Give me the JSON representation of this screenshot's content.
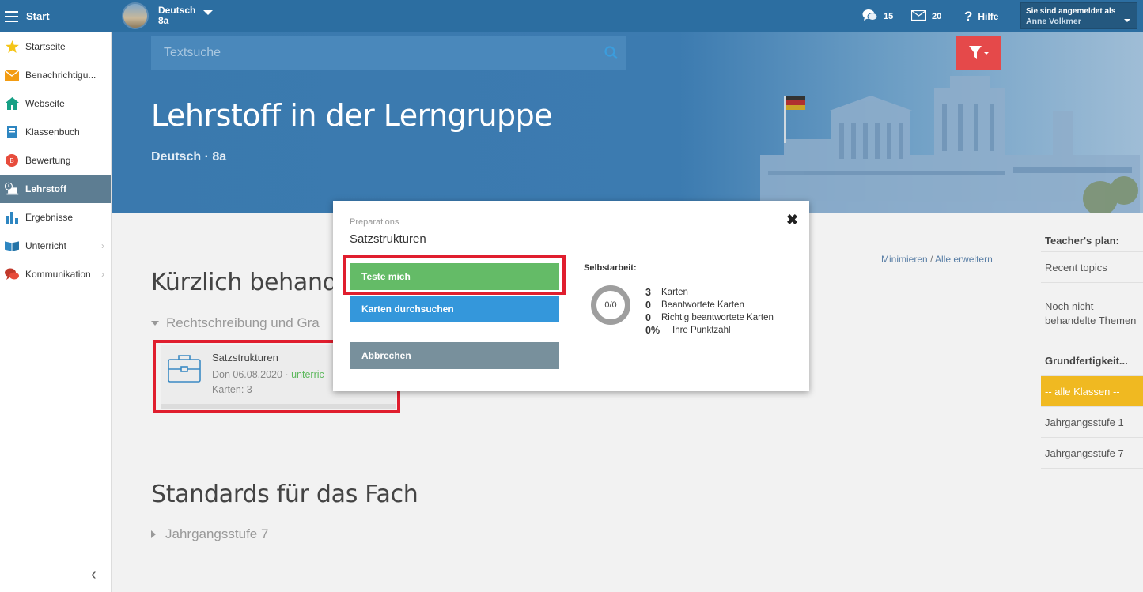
{
  "topbar": {
    "start_label": "Start",
    "group_subject": "Deutsch",
    "group_class": "8a",
    "messages_count": "15",
    "mail_count": "20",
    "help_label": "Hilfe",
    "logged_in_label": "Sie sind angemeldet als",
    "user_name": "Anne Volkmer"
  },
  "sidebar": {
    "items": [
      {
        "label": "Startseite"
      },
      {
        "label": "Benachrichtigu..."
      },
      {
        "label": "Webseite"
      },
      {
        "label": "Klassenbuch"
      },
      {
        "label": "Bewertung"
      },
      {
        "label": "Lehrstoff"
      },
      {
        "label": "Ergebnisse"
      },
      {
        "label": "Unterricht"
      },
      {
        "label": "Kommunikation"
      }
    ],
    "active_index": 5
  },
  "hero": {
    "search_placeholder": "Textsuche",
    "title": "Lehrstoff in der Lerngruppe",
    "subtitle": "Deutsch · 8a"
  },
  "main": {
    "recent_title": "Kürzlich behand",
    "recent_group": "Rechtschreibung und Gra",
    "minimize_label": "Minimieren",
    "links_separator": "/",
    "expand_all_label": "Alle erweitern",
    "card": {
      "title": "Satzstrukturen",
      "date": "Don 06.08.2020 · ",
      "status": "unterric",
      "count": "Karten: 3"
    },
    "standards_title": "Standards für das Fach",
    "standards_group": "Jahrgangsstufe 7"
  },
  "right_panel": {
    "items": [
      {
        "label": "Teacher's plan:",
        "type": "head",
        "height": 29
      },
      {
        "label": "Recent topics",
        "type": "item",
        "height": 39
      },
      {
        "label": "Noch nicht behandelte Themen",
        "type": "item",
        "height": 79
      },
      {
        "label": "Grundfertigkeit...",
        "type": "head",
        "height": 39
      },
      {
        "label": "-- alle Klassen --",
        "type": "sel",
        "height": 39
      },
      {
        "label": "Jahrgangsstufe 1",
        "type": "item",
        "height": 39
      },
      {
        "label": "Jahrgangsstufe 7",
        "type": "item",
        "height": 39
      }
    ]
  },
  "modal": {
    "breadcrumb": "Preparations",
    "title": "Satzstrukturen",
    "close_label": "✖",
    "test_button": "Teste mich",
    "browse_button": "Karten durchsuchen",
    "cancel_button": "Abbrechen",
    "self_label": "Selbstarbeit:",
    "progress_text": "0/0",
    "stats": [
      {
        "num": "3",
        "label": "Karten"
      },
      {
        "num": "0",
        "label": "Beantwortete Karten"
      },
      {
        "num": "0",
        "label": "Richtig beantwortete Karten"
      },
      {
        "num": "0%",
        "label": "Ihre Punktzahl"
      }
    ]
  },
  "colors": {
    "topbar": "#2c6ea1",
    "hero": "#3a79ae",
    "active_nav": "#5d7d92",
    "green_button": "#64bb67",
    "blue_button": "#3497db",
    "gray_button": "#78909c",
    "filter_button": "#e5494a",
    "selected_filter": "#f0b921",
    "highlight": "#e01e2e"
  }
}
